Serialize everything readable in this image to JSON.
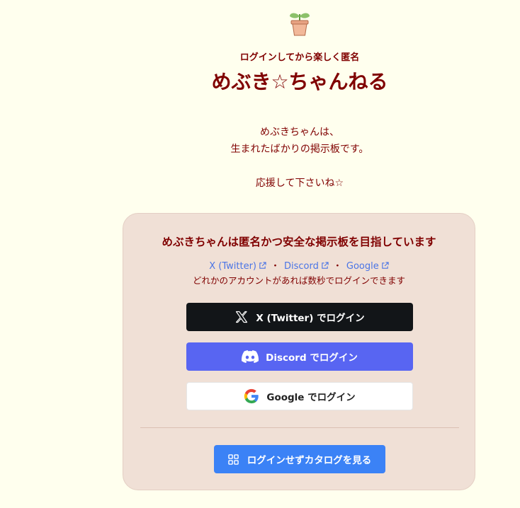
{
  "header": {
    "tagline": "ログインしてから楽しく匿名",
    "title": "めぶき☆ちゃんねる",
    "intro_line1": "めぶきちゃんは、",
    "intro_line2": "生まれたばかりの掲示板です。",
    "intro_line3": "応援して下さいね☆"
  },
  "login_card": {
    "heading": "めぶきちゃんは匿名かつ安全な掲示板を目指しています",
    "provider_links": [
      {
        "label": "X (Twitter)"
      },
      {
        "label": "Discord"
      },
      {
        "label": "Google"
      }
    ],
    "separator": "・",
    "note": "どれかのアカウントがあれば数秒でログインできます",
    "buttons": {
      "x": "X (Twitter) でログイン",
      "discord": "Discord でログイン",
      "google": "Google でログイン"
    },
    "catalog_button": "ログインせずカタログを見る"
  },
  "colors": {
    "background": "#ffffee",
    "text_primary": "#800000",
    "card_background": "#f0e0d6",
    "link": "#4a74e6",
    "x_button": "#121518",
    "discord_button": "#5865f2",
    "catalog_button": "#3b82f6"
  },
  "icons": {
    "logo": "sprout-pot-icon",
    "external": "external-link-icon",
    "x": "x-logo-icon",
    "discord": "discord-logo-icon",
    "google": "google-logo-icon",
    "catalog": "grid-icon"
  }
}
